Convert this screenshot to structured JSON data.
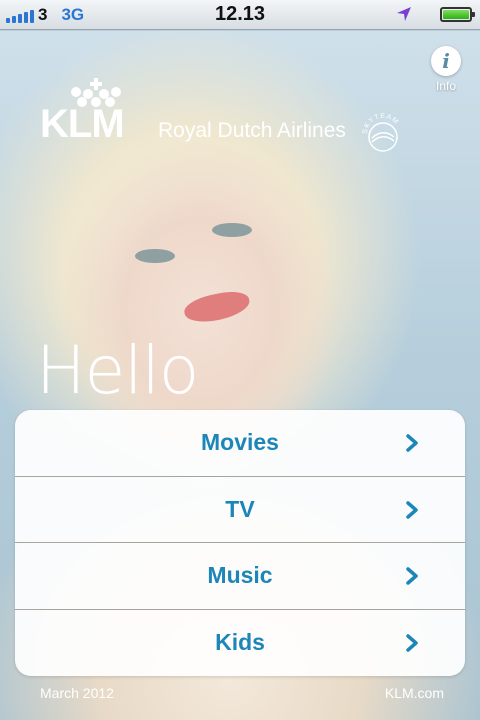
{
  "status_bar": {
    "carrier": "3",
    "network": "3G",
    "time": "12.13",
    "icons": [
      "signal-bars-icon",
      "location-arrow-icon",
      "battery-icon"
    ],
    "signal_bars": 5,
    "battery_level": 1.0
  },
  "info": {
    "label": "Info",
    "icon": "info-icon"
  },
  "logo": {
    "brand": "KLM",
    "tagline": "Royal Dutch Airlines",
    "alliance": "SKYTEAM"
  },
  "hero": {
    "greeting": "Hello"
  },
  "menu": {
    "items": [
      {
        "label": "Movies"
      },
      {
        "label": "TV"
      },
      {
        "label": "Music"
      },
      {
        "label": "Kids"
      }
    ]
  },
  "footer": {
    "date": "March 2012",
    "link": "KLM.com"
  },
  "colors": {
    "accent": "#1d86b8",
    "signal": "#2a76d2",
    "battery": "#2fae1a"
  }
}
